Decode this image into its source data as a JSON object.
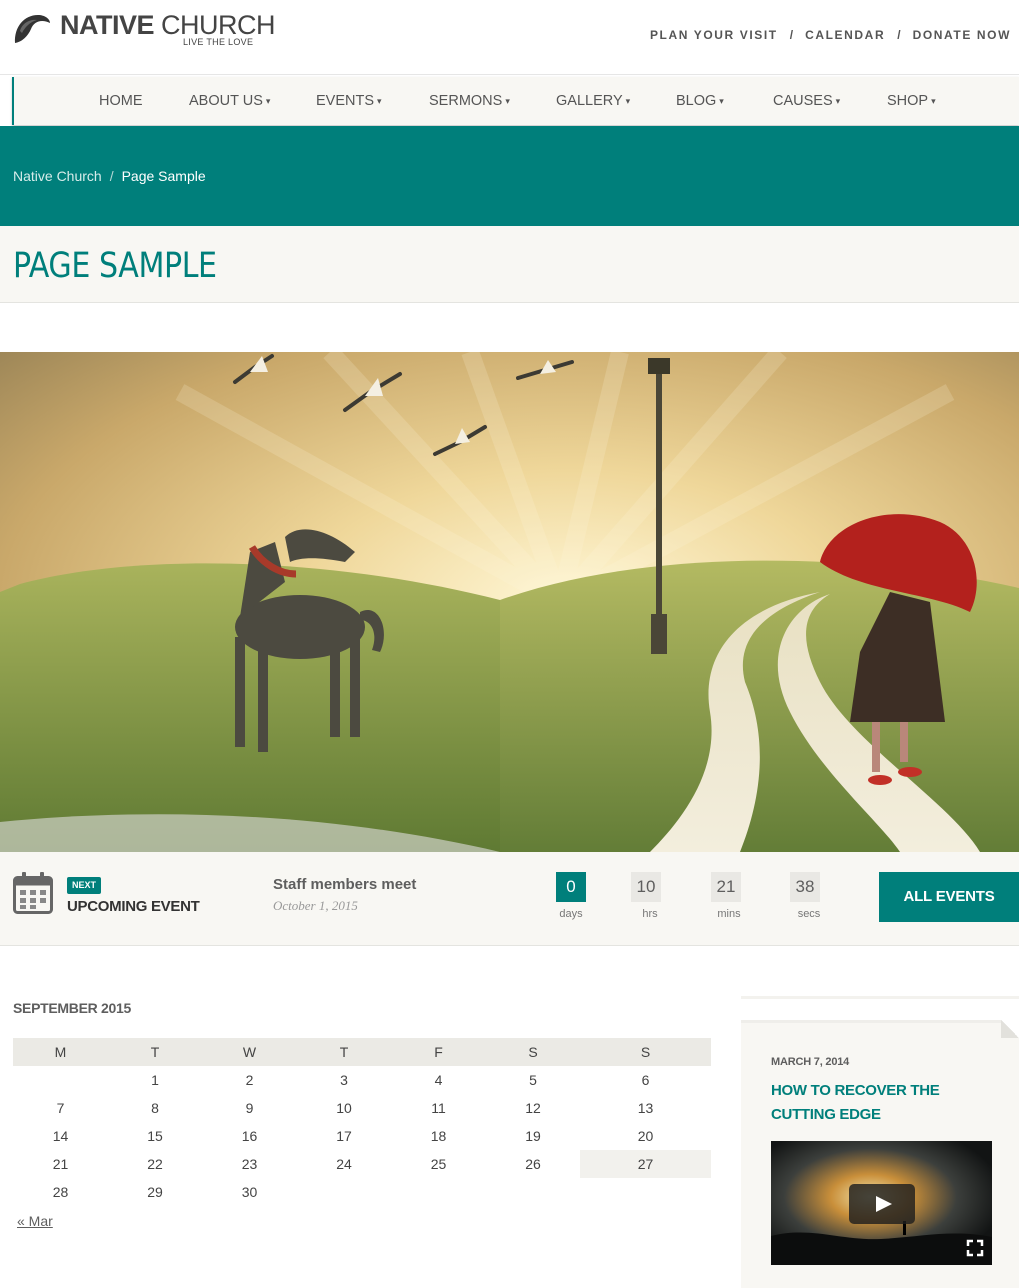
{
  "brand": {
    "name_bold": "NATIVE",
    "name_light": "CHURCH",
    "tagline": "LIVE THE LOVE",
    "logo_icon": "church-logo-icon"
  },
  "top_links": [
    {
      "label": "PLAN YOUR VISIT"
    },
    {
      "label": "CALENDAR"
    },
    {
      "label": "DONATE NOW"
    }
  ],
  "top_link_separator": "/",
  "nav": [
    {
      "label": "HOME",
      "caret": ""
    },
    {
      "label": "ABOUT US",
      "caret": "⌄"
    },
    {
      "label": "EVENTS",
      "caret": "⌄"
    },
    {
      "label": "SERMONS",
      "caret": "⌄"
    },
    {
      "label": "GALLERY",
      "caret": "⌄"
    },
    {
      "label": "BLOG",
      "caret": "⌄"
    },
    {
      "label": "CAUSES",
      "caret": "⌄"
    },
    {
      "label": "SHOP",
      "caret": "⌄"
    }
  ],
  "breadcrumb": {
    "home": "Native Church",
    "separator": "/",
    "current": "Page Sample"
  },
  "page_title": "PAGE SAMPLE",
  "hero": {
    "description_icon": "hero-illustration"
  },
  "upcoming_event": {
    "badge": "NEXT",
    "label": "UPCOMING EVENT",
    "title": "Staff members meet",
    "date": "October 1, 2015",
    "countdown": [
      {
        "value": "0",
        "unit": "days"
      },
      {
        "value": "10",
        "unit": "hrs"
      },
      {
        "value": "21",
        "unit": "mins"
      },
      {
        "value": "38",
        "unit": "secs"
      }
    ],
    "button": "ALL EVENTS"
  },
  "calendar": {
    "caption": "SEPTEMBER 2015",
    "weekdays": [
      "M",
      "T",
      "W",
      "T",
      "F",
      "S",
      "S"
    ],
    "weeks": [
      [
        "",
        "1",
        "2",
        "3",
        "4",
        "5",
        "6"
      ],
      [
        "7",
        "8",
        "9",
        "10",
        "11",
        "12",
        "13"
      ],
      [
        "14",
        "15",
        "16",
        "17",
        "18",
        "19",
        "20"
      ],
      [
        "21",
        "22",
        "23",
        "24",
        "25",
        "26",
        "27"
      ],
      [
        "28",
        "29",
        "30",
        "",
        "",
        "",
        ""
      ]
    ],
    "highlighted_day": "27",
    "prev_link": "« Mar"
  },
  "sidebar_post": {
    "date": "MARCH 7, 2014",
    "title": "HOW TO RECOVER THE CUTTING EDGE"
  },
  "colors": {
    "accent": "#007f7b",
    "panel": "#f8f7f3",
    "text": "#5e5e5e"
  }
}
